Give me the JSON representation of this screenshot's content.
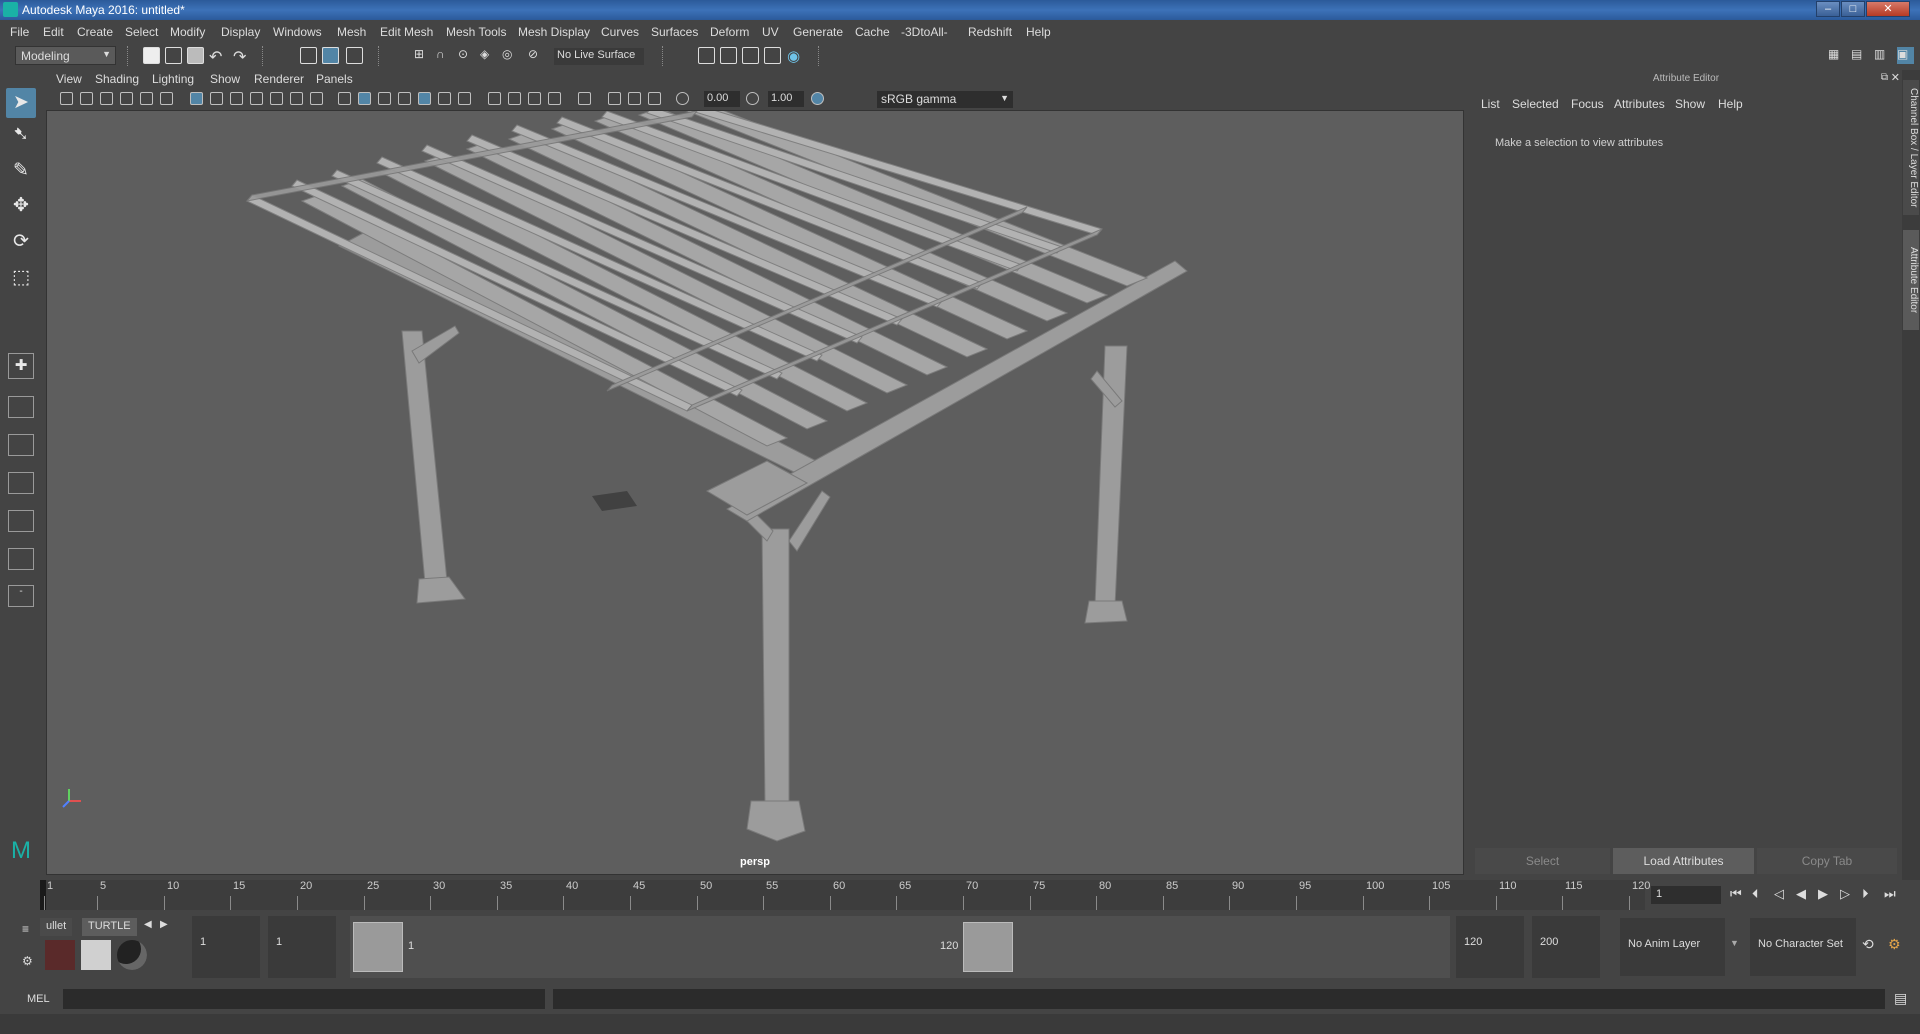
{
  "title": "Autodesk Maya 2016: untitled*",
  "window_buttons": [
    "minimize",
    "maximize",
    "close"
  ],
  "menubar": [
    "File",
    "Edit",
    "Create",
    "Select",
    "Modify",
    "Display",
    "Windows",
    "Mesh",
    "Edit Mesh",
    "Mesh Tools",
    "Mesh Display",
    "Curves",
    "Surfaces",
    "Deform",
    "UV",
    "Generate",
    "Cache",
    "-3DtoAll-",
    "Redshift",
    "Help"
  ],
  "status": {
    "mode": "Modeling",
    "live_surface": "No Live Surface"
  },
  "viewport": {
    "menu": [
      "View",
      "Shading",
      "Lighting",
      "Show",
      "Renderer",
      "Panels"
    ],
    "exposure": "0.00",
    "gamma_value": "1.00",
    "color_space": "sRGB gamma",
    "camera_label": "persp"
  },
  "attribute_editor": {
    "header": "Attribute Editor",
    "menu": [
      "List",
      "Selected",
      "Focus",
      "Attributes",
      "Show",
      "Help"
    ],
    "message": "Make a selection to view attributes",
    "buttons": {
      "select": "Select",
      "load": "Load Attributes",
      "copy": "Copy Tab"
    }
  },
  "side_tabs": {
    "channel_box": "Channel Box / Layer Editor",
    "attribute_editor": "Attribute Editor"
  },
  "timeline": {
    "ticks": [
      "1",
      "5",
      "10",
      "15",
      "20",
      "25",
      "30",
      "35",
      "40",
      "45",
      "50",
      "55",
      "60",
      "65",
      "70",
      "75",
      "80",
      "85",
      "90",
      "95",
      "100",
      "105",
      "110",
      "115",
      "120"
    ],
    "current_frame": "1"
  },
  "range": {
    "shelf_tabs": [
      "ullet",
      "TURTLE"
    ],
    "start_time": "1",
    "playback_start": "1",
    "range_start_label": "1",
    "range_end_label": "120",
    "playback_end": "120",
    "end_time": "200",
    "anim_layer": "No Anim Layer",
    "character_set": "No Character Set"
  },
  "command_line": {
    "label": "MEL"
  }
}
